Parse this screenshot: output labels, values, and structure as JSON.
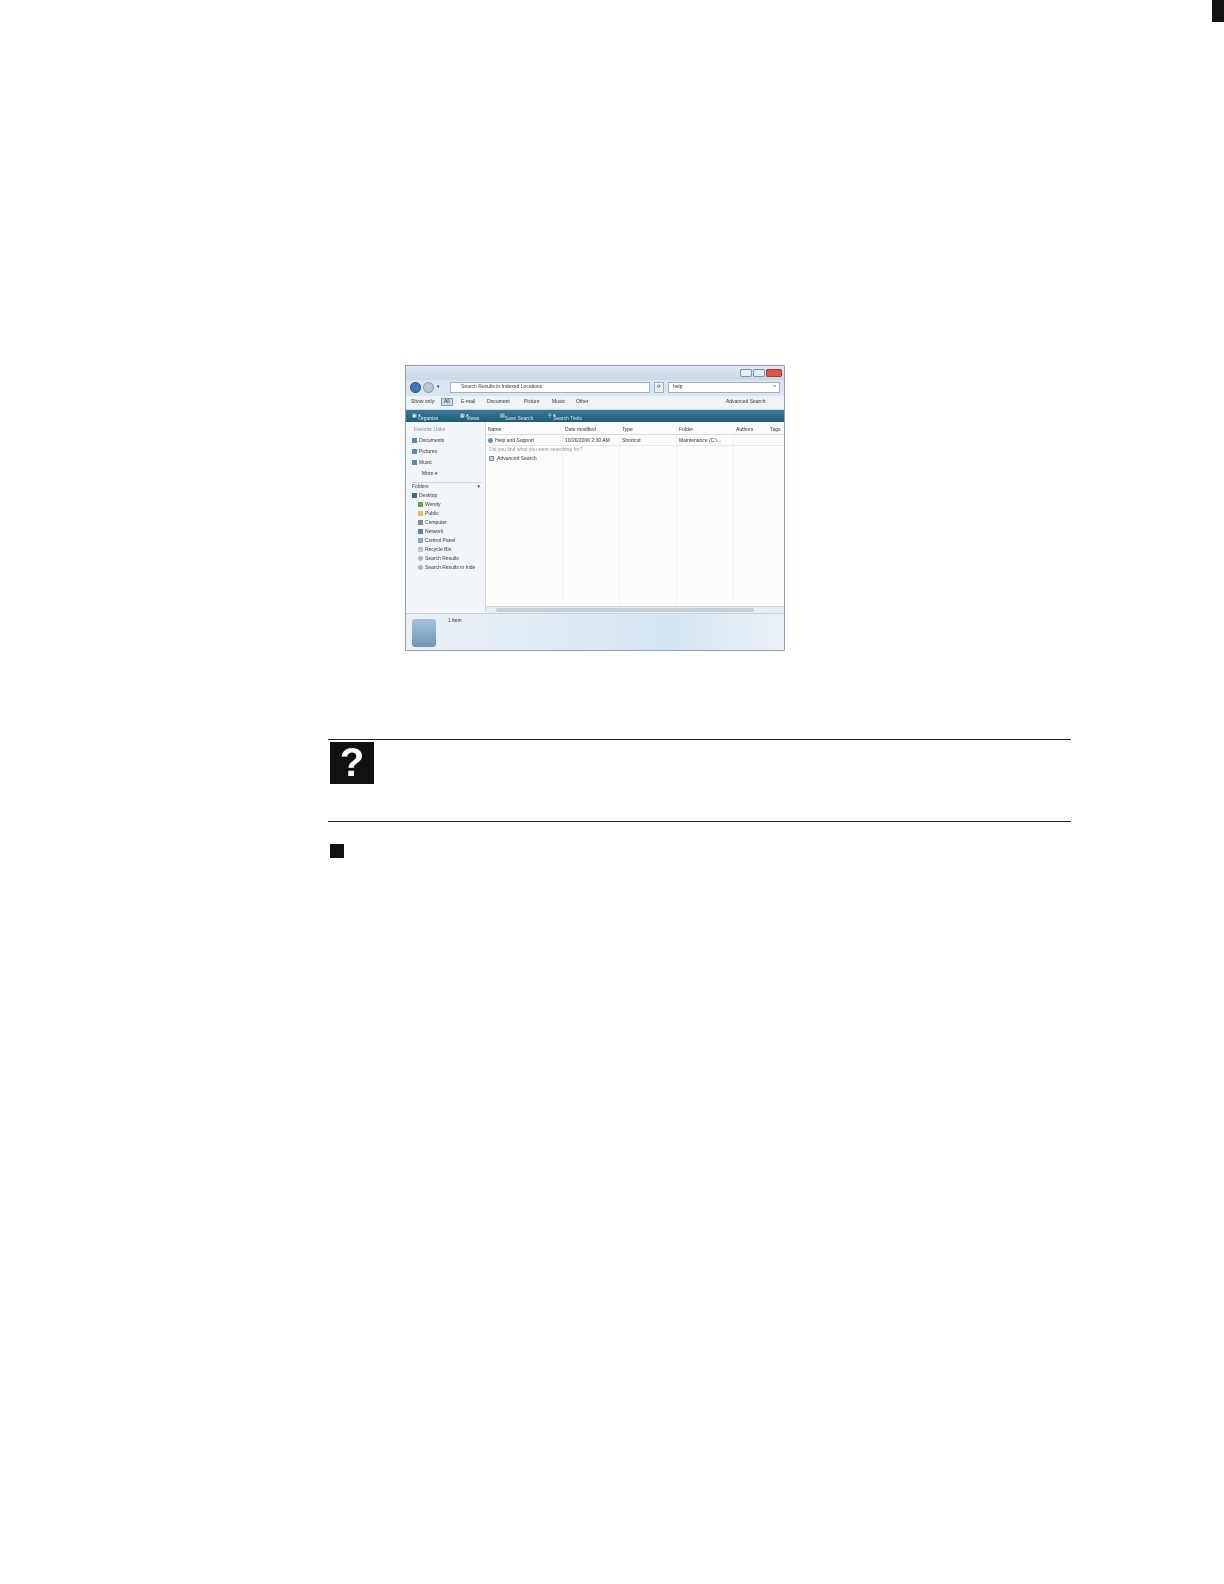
{
  "window": {
    "address": "Search Results in Indexed Locations",
    "search_value": "help",
    "show_only_label": "Show only:",
    "filters": [
      "All",
      "E-mail",
      "Document",
      "Picture",
      "Music",
      "Other"
    ],
    "advanced_search": "Advanced Search",
    "toolbar": [
      "Organize",
      "Views",
      "Save Search",
      "Search Tools"
    ],
    "favorite_links_header": "Favorite Links",
    "favorites": [
      "Documents",
      "Pictures",
      "Music"
    ],
    "more_label": "More",
    "folders_header": "Folders",
    "folders": [
      "Desktop",
      "Wendy",
      "Public",
      "Computer",
      "Network",
      "Control Panel",
      "Recycle Bin",
      "Search Results",
      "Search Results in Inde"
    ],
    "columns": [
      "Name",
      "Date modified",
      "Type",
      "Folder",
      "Authors",
      "Tags"
    ],
    "row": {
      "name": "Help and Support",
      "date": "10/26/2006 2:30 AM",
      "type": "Shortcut",
      "folder": "Maintenance (C:\\..."
    },
    "did_you_find": "Did you find what you were searching for?",
    "advanced_search_link": "Advanced Search",
    "item_count": "1 item"
  }
}
